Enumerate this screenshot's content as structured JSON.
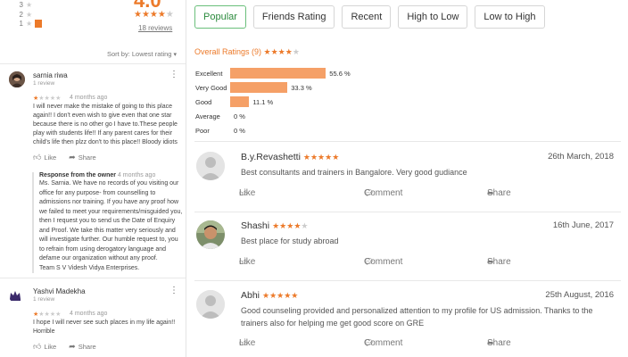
{
  "left": {
    "histogram": [
      {
        "label": "3",
        "fill": 0
      },
      {
        "label": "2",
        "fill": 0
      },
      {
        "label": "1",
        "fill": 1
      }
    ],
    "rating_value": "4.0",
    "review_count_link": "18 reviews",
    "sort_by": "Sort by: Lowest rating",
    "reviews": [
      {
        "name": "sarnia riwa",
        "sub": "1 review",
        "stars": 1,
        "ago": "4 months ago",
        "body": "I will never make the mistake of going to this place again!! I don't even wish to give even that one star because there is no other go I have to.These people play with students life!! If any parent cares for their child's life then plzz don't to this place!! Bloody idiots",
        "like": "Like",
        "share": "Share",
        "owner_title": "Response from the owner",
        "owner_ago": "4 months ago",
        "owner_body": "Ms. Sarnia. We have no records of you visiting our office for any purpose- from counselling to admissions nor training. If you have any proof how we failed to meet your requirements/misguided you, then I request you to send us the Date of Enquiry and Proof. We take this matter very seriously and will investigate further. Our humble request to, you to refrain from using derogatory language and defame our organization without any proof.\nTeam S V Videsh Vidya Enterprises."
      },
      {
        "name": "Yashvi Madekha",
        "sub": "1 review",
        "stars": 1,
        "ago": "4 months ago",
        "body": "I hope I will never see such places in my life again!! Horrible",
        "like": "Like",
        "share": "Share"
      }
    ]
  },
  "right": {
    "tabs": [
      {
        "label": "Popular",
        "active": true
      },
      {
        "label": "Friends Rating",
        "active": false
      },
      {
        "label": "Recent",
        "active": false
      },
      {
        "label": "High to Low",
        "active": false
      },
      {
        "label": "Low to High",
        "active": false
      }
    ],
    "overall_label": "Overall Ratings (9)",
    "overall_stars": 4.5,
    "distribution": [
      {
        "label": "Excellent",
        "pct": 55.6,
        "text": "55.6 %"
      },
      {
        "label": "Very Good",
        "pct": 33.3,
        "text": "33.3 %"
      },
      {
        "label": "Good",
        "pct": 11.1,
        "text": "11.1 %"
      },
      {
        "label": "Average",
        "pct": 0,
        "text": "0 %"
      },
      {
        "label": "Poor",
        "pct": 0,
        "text": "0 %"
      }
    ],
    "reviews": [
      {
        "name": "B.y.Revashetti",
        "stars": "★★★★★",
        "date": "26th March, 2018",
        "body": "Best consultants and trainers in Bangalore. Very good gudiance",
        "like": "Like",
        "comment": "Comment",
        "share": "Share"
      },
      {
        "name": "Shashi",
        "stars": "★★★★",
        "stars_off": "★",
        "date": "16th June, 2017",
        "body": "Best place for study abroad",
        "like": "Like",
        "comment": "Comment",
        "share": "Share"
      },
      {
        "name": "Abhi",
        "stars": "★★★★★",
        "date": "25th August, 2016",
        "body": "Good counseling provided and personalized attention to my profile for US admission. Thanks to the trainers also for helping me get good score on GRE",
        "like": "Like",
        "comment": "Comment",
        "share": "Share"
      }
    ]
  },
  "colors": {
    "accent_orange": "#ec7a2a",
    "bar_orange": "#f5a067",
    "active_tab_green": "#2a8a3c"
  }
}
